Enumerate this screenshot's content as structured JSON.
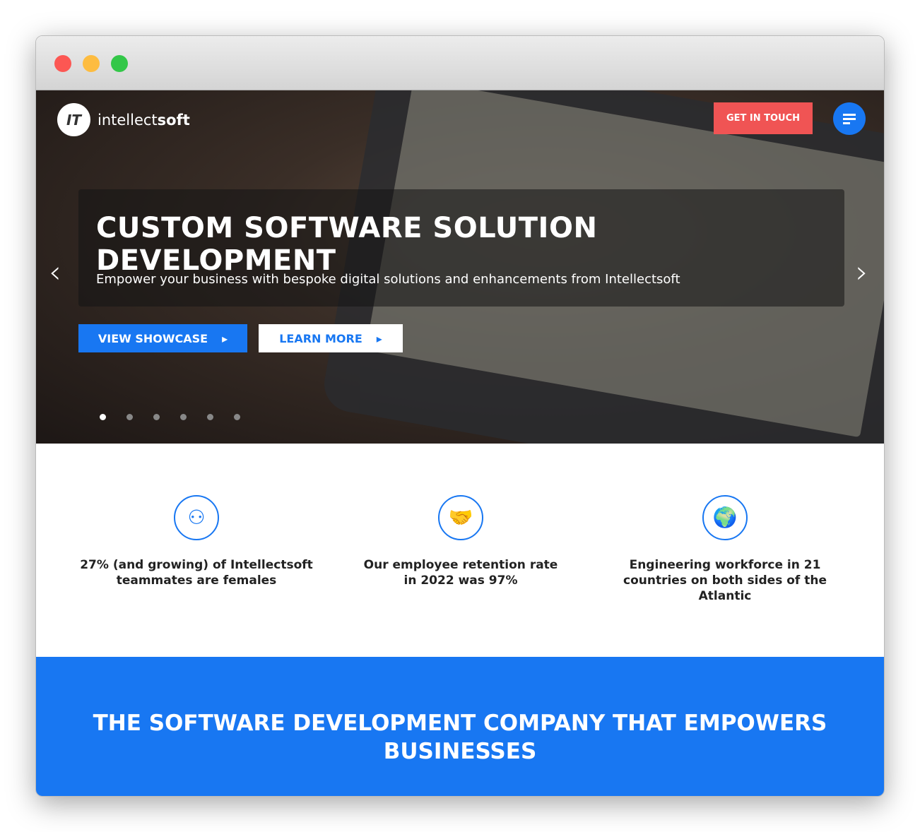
{
  "window": {
    "controls": [
      "close",
      "minimize",
      "maximize"
    ]
  },
  "header": {
    "logo_mark": "IT",
    "logo_light": "intellect",
    "logo_bold": "soft",
    "cta": "GET IN TOUCH"
  },
  "hero": {
    "title": "CUSTOM SOFTWARE SOLUTION DEVELOPMENT",
    "subtitle": "Empower your business with bespoke digital solutions and enhancements from Intellectsoft",
    "prev": "‹",
    "next": "›",
    "buttons": [
      {
        "label": "VIEW SHOWCASE",
        "icon": "▸"
      },
      {
        "label": "LEARN MORE",
        "icon": "▸"
      }
    ],
    "slides": 6,
    "active_slide": 1
  },
  "stats": [
    {
      "icon": "people-circle-icon",
      "glyph": "⚇",
      "text": "27% (and growing) of Intellectsoft teammates are females"
    },
    {
      "icon": "handshake-icon",
      "glyph": "🤝",
      "text": "Our employee retention rate in 2022 was 97%"
    },
    {
      "icon": "globe-icon",
      "glyph": "🌍",
      "text": "Engineering workforce in 21 countries on both sides of the Atlantic"
    }
  ],
  "band": {
    "title": "THE SOFTWARE DEVELOPMENT COMPANY THAT EMPOWERS BUSINESSES"
  },
  "colors": {
    "accent": "#1877f2",
    "cta": "#f05454"
  }
}
